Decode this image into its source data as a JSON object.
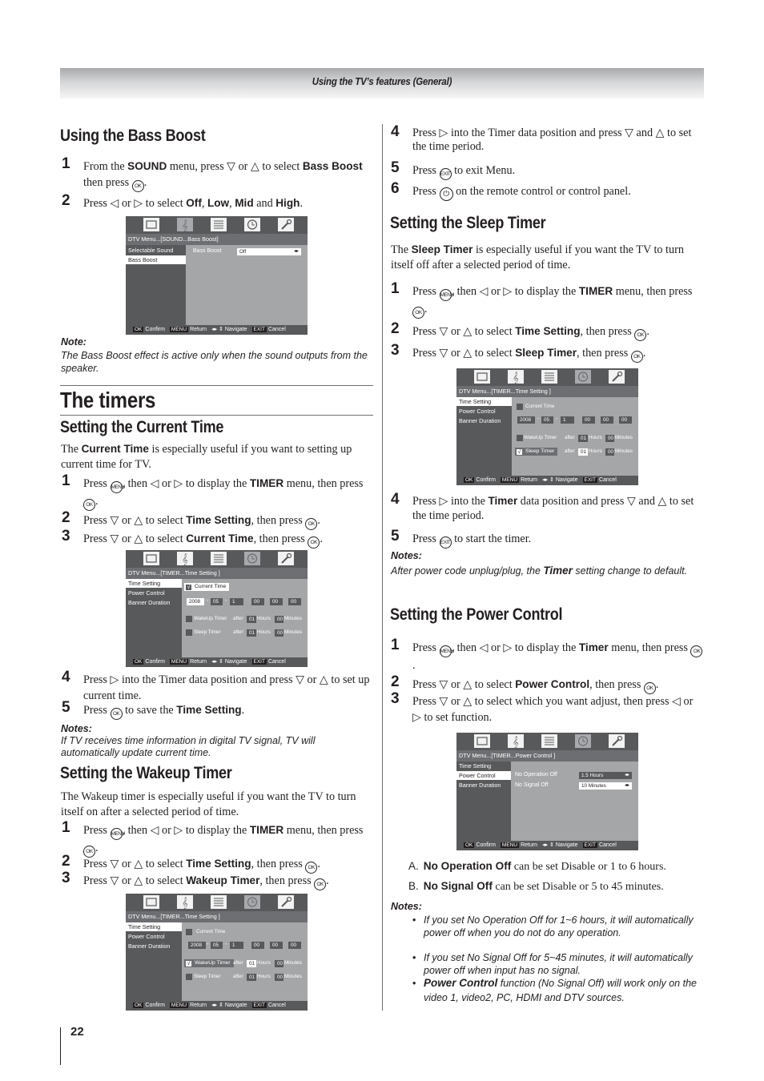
{
  "header": {
    "title": "Using the TV’s features (General)"
  },
  "page_number": "22",
  "bass_boost": {
    "heading": "Using the Bass Boost",
    "step1": {
      "num": "1",
      "a": "From the ",
      "b1": "SOUND",
      "c": " menu, press ▽ or △ to select ",
      "b2": "Bass Boost",
      "d": " then press ",
      "e": "."
    },
    "step2": {
      "num": "2",
      "a": "Press ◁ or ▷ to select ",
      "b1": "Off",
      "c1": ", ",
      "b2": "Low",
      "c2": ", ",
      "b3": "Mid",
      "c3": " and ",
      "b4": "High",
      "d": "."
    },
    "screen": {
      "crumb": "DTV Menu...[SOUND...Bass Boost]",
      "side": [
        "Selectable Sound",
        "Bass Boost"
      ],
      "field_label": "Bass Boost",
      "field_value": "Off"
    },
    "note_heading": "Note:",
    "note_text": "The Bass Boost effect is active only when the sound outputs from the speaker."
  },
  "timers": {
    "heading": "The timers"
  },
  "current_time": {
    "heading": "Setting the Current Time",
    "intro_a": "The ",
    "intro_b": "Current Time",
    "intro_c": " is especially useful if you want to setting up current time for TV.",
    "step1": {
      "num": "1",
      "a": "Press ",
      "b": ", then ◁ or ▷ to display the ",
      "bold": "TIMER",
      "c": " menu, then press ",
      "d": "."
    },
    "step2": {
      "num": "2",
      "a": "Press ▽ or △ to select ",
      "bold": "Time Setting",
      "c": ", then press ",
      "d": "."
    },
    "step3": {
      "num": "3",
      "a": "Press ▽ or △ to select ",
      "bold": "Current  Time",
      "c": ", then press ",
      "d": "."
    },
    "step4": {
      "num": "4",
      "a": "Press ▷ into the Timer data position and press ▽ or △ to set up current time."
    },
    "step5": {
      "num": "5",
      "a": "Press ",
      "b": " to save the ",
      "bold": "Time Setting",
      "c": "."
    },
    "note_heading": "Notes:",
    "note_text": "If TV receives time information in digital TV signal, TV will automatically update current time."
  },
  "wakeup": {
    "heading": "Setting the Wakeup Timer",
    "intro": "The Wakeup timer is especially useful if you want the TV to turn itself on after a selected period of time.",
    "step1": {
      "num": "1",
      "a": "Press ",
      "b": ", then ◁ or ▷ to display the ",
      "bold": "TIMER",
      "c": " menu, then press ",
      "d": "."
    },
    "step2": {
      "num": "2",
      "a": "Press ▽ or △ to select ",
      "bold": "Time Setting",
      "c": ", then press ",
      "d": "."
    },
    "step3": {
      "num": "3",
      "a": "Press ▽ or △ to select ",
      "bold": "Wakeup Timer",
      "c": ", then press ",
      "d": "."
    },
    "step4": {
      "num": "4",
      "a": "Press ▷ into the Timer data position and press ▽ and △ to set the time period."
    },
    "step5": {
      "num": "5",
      "a": "Press ",
      "b": " to exit Menu."
    },
    "step6": {
      "num": "6",
      "a": "Press ",
      "b": " on the remote control or control panel."
    }
  },
  "sleep": {
    "heading": "Setting the Sleep Timer",
    "intro_a": "The ",
    "intro_b": "Sleep Timer",
    "intro_c": " is especially useful if you want the TV to turn itself off after a selected period of time.",
    "step1": {
      "num": "1",
      "a": "Press ",
      "b": ", then ◁ or ▷ to display the ",
      "bold": "TIMER",
      "c": " menu, then press ",
      "d": "."
    },
    "step2": {
      "num": "2",
      "a": "Press ▽ or △ to select ",
      "bold": "Time Setting",
      "c": ", then press ",
      "d": "."
    },
    "step3": {
      "num": "3",
      "a": "Press ▽ or △ to select ",
      "bold": "Sleep Timer",
      "c": ", then press ",
      "d": "."
    },
    "step4": {
      "num": "4",
      "a": "Press ▷ into the ",
      "bold": "Timer",
      "c": " data position and press ▽ and △ to set the time period."
    },
    "step5": {
      "num": "5",
      "a": "Press ",
      "b": " to start the timer."
    },
    "note_heading": "Notes:",
    "note_a": "After power code unplug/plug, the ",
    "note_b": "Timer",
    "note_c": " setting change to default."
  },
  "power": {
    "heading": "Setting the Power Control",
    "step1": {
      "num": "1",
      "a": "Press ",
      "b": ", then ◁ or ▷ to display the ",
      "bold": "Timer",
      "c": " menu, then press ",
      "d": "."
    },
    "step2": {
      "num": "2",
      "a": "Press ▽ or △ to select ",
      "bold": "Power Control",
      "c": ", then press ",
      "d": "."
    },
    "step3": {
      "num": "3",
      "a": "Press ▽ or △ to select which you want adjust, then press ◁ or ▷ to set function."
    },
    "screen": {
      "crumb": "DTV Menu...[TIMER...Power Control ]",
      "row1_label": "No Operation Off",
      "row1_value": "1.5 Hours",
      "row2_label": "No Signal Off",
      "row2_value": "10 Minutes"
    },
    "itemA": {
      "letter": "A.",
      "bold": "No Operation Off",
      "text": " can be set Disable or 1 to 6 hours."
    },
    "itemB": {
      "letter": "B.",
      "bold": "No Signal Off",
      "text": " can be set Disable or 5 to 45 minutes."
    },
    "note_heading": "Notes:",
    "bullets": [
      "If you set No Operation Off for 1~6 hours, it will automatically power off when you do not do any operation.",
      "If you set No Signal Off for 5~45 minutes, it will automatically power off when input has no signal."
    ],
    "bullet3_bold": "Power Control",
    "bullet3_text": " function (No Signal Off) will work only on the video 1, video2, PC, HDMI and DTV sources."
  },
  "timer_screen": {
    "crumb": "DTV Menu...[TIMER...Time Setting ]",
    "side": [
      "Time Setting",
      "Power Control",
      "Banner Duration"
    ],
    "current_time": "Current Time",
    "date": [
      "2008",
      "05",
      "1"
    ],
    "time": [
      "00",
      "00",
      "00"
    ],
    "wakeup_label": "WakeUp Timer",
    "sleep_label": "Sleep Timer",
    "after": "after",
    "hours_val": "01",
    "hours": "Hours",
    "minutes_val": "00",
    "minutes": "Minutes",
    "check": "√"
  },
  "footer_keys": {
    "ok": "OK",
    "confirm": "Confirm",
    "menu": "MENU",
    "return": "Return",
    "nav": "◂▸ ⇕ Navigate",
    "exit": "EXIT",
    "cancel": "Cancel"
  },
  "buttons": {
    "ok": "OK",
    "menu": "MENU",
    "exit": "EXIT",
    "power": "⏻"
  },
  "tv_icons": [
    "tv-picture-icon",
    "sound-note-icon",
    "setup-list-icon",
    "timer-clock-icon",
    "wrench-icon"
  ]
}
